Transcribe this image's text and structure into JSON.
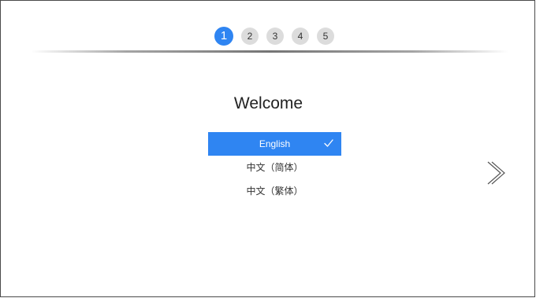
{
  "steps": [
    {
      "label": "1",
      "active": true
    },
    {
      "label": "2",
      "active": false
    },
    {
      "label": "3",
      "active": false
    },
    {
      "label": "4",
      "active": false
    },
    {
      "label": "5",
      "active": false
    }
  ],
  "welcome": {
    "title": "Welcome"
  },
  "languages": [
    {
      "label": "English",
      "selected": true
    },
    {
      "label": "中文（简体）",
      "selected": false
    },
    {
      "label": "中文（繁体）",
      "selected": false
    }
  ],
  "icons": {
    "check": "check-icon",
    "next": "chevron-right-icon"
  },
  "colors": {
    "accent": "#2f85f2",
    "step_inactive": "#dcdcdc"
  }
}
